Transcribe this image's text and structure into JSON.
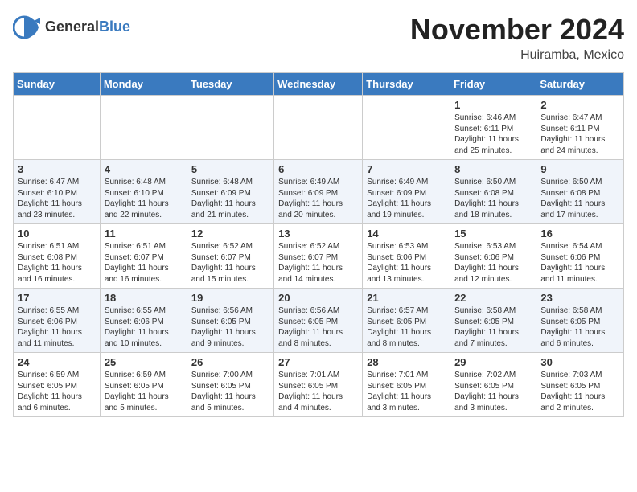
{
  "header": {
    "logo_general": "General",
    "logo_blue": "Blue",
    "month_title": "November 2024",
    "location": "Huiramba, Mexico"
  },
  "weekdays": [
    "Sunday",
    "Monday",
    "Tuesday",
    "Wednesday",
    "Thursday",
    "Friday",
    "Saturday"
  ],
  "weeks": [
    [
      {
        "day": "",
        "info": ""
      },
      {
        "day": "",
        "info": ""
      },
      {
        "day": "",
        "info": ""
      },
      {
        "day": "",
        "info": ""
      },
      {
        "day": "",
        "info": ""
      },
      {
        "day": "1",
        "info": "Sunrise: 6:46 AM\nSunset: 6:11 PM\nDaylight: 11 hours and 25 minutes."
      },
      {
        "day": "2",
        "info": "Sunrise: 6:47 AM\nSunset: 6:11 PM\nDaylight: 11 hours and 24 minutes."
      }
    ],
    [
      {
        "day": "3",
        "info": "Sunrise: 6:47 AM\nSunset: 6:10 PM\nDaylight: 11 hours and 23 minutes."
      },
      {
        "day": "4",
        "info": "Sunrise: 6:48 AM\nSunset: 6:10 PM\nDaylight: 11 hours and 22 minutes."
      },
      {
        "day": "5",
        "info": "Sunrise: 6:48 AM\nSunset: 6:09 PM\nDaylight: 11 hours and 21 minutes."
      },
      {
        "day": "6",
        "info": "Sunrise: 6:49 AM\nSunset: 6:09 PM\nDaylight: 11 hours and 20 minutes."
      },
      {
        "day": "7",
        "info": "Sunrise: 6:49 AM\nSunset: 6:09 PM\nDaylight: 11 hours and 19 minutes."
      },
      {
        "day": "8",
        "info": "Sunrise: 6:50 AM\nSunset: 6:08 PM\nDaylight: 11 hours and 18 minutes."
      },
      {
        "day": "9",
        "info": "Sunrise: 6:50 AM\nSunset: 6:08 PM\nDaylight: 11 hours and 17 minutes."
      }
    ],
    [
      {
        "day": "10",
        "info": "Sunrise: 6:51 AM\nSunset: 6:08 PM\nDaylight: 11 hours and 16 minutes."
      },
      {
        "day": "11",
        "info": "Sunrise: 6:51 AM\nSunset: 6:07 PM\nDaylight: 11 hours and 16 minutes."
      },
      {
        "day": "12",
        "info": "Sunrise: 6:52 AM\nSunset: 6:07 PM\nDaylight: 11 hours and 15 minutes."
      },
      {
        "day": "13",
        "info": "Sunrise: 6:52 AM\nSunset: 6:07 PM\nDaylight: 11 hours and 14 minutes."
      },
      {
        "day": "14",
        "info": "Sunrise: 6:53 AM\nSunset: 6:06 PM\nDaylight: 11 hours and 13 minutes."
      },
      {
        "day": "15",
        "info": "Sunrise: 6:53 AM\nSunset: 6:06 PM\nDaylight: 11 hours and 12 minutes."
      },
      {
        "day": "16",
        "info": "Sunrise: 6:54 AM\nSunset: 6:06 PM\nDaylight: 11 hours and 11 minutes."
      }
    ],
    [
      {
        "day": "17",
        "info": "Sunrise: 6:55 AM\nSunset: 6:06 PM\nDaylight: 11 hours and 11 minutes."
      },
      {
        "day": "18",
        "info": "Sunrise: 6:55 AM\nSunset: 6:06 PM\nDaylight: 11 hours and 10 minutes."
      },
      {
        "day": "19",
        "info": "Sunrise: 6:56 AM\nSunset: 6:05 PM\nDaylight: 11 hours and 9 minutes."
      },
      {
        "day": "20",
        "info": "Sunrise: 6:56 AM\nSunset: 6:05 PM\nDaylight: 11 hours and 8 minutes."
      },
      {
        "day": "21",
        "info": "Sunrise: 6:57 AM\nSunset: 6:05 PM\nDaylight: 11 hours and 8 minutes."
      },
      {
        "day": "22",
        "info": "Sunrise: 6:58 AM\nSunset: 6:05 PM\nDaylight: 11 hours and 7 minutes."
      },
      {
        "day": "23",
        "info": "Sunrise: 6:58 AM\nSunset: 6:05 PM\nDaylight: 11 hours and 6 minutes."
      }
    ],
    [
      {
        "day": "24",
        "info": "Sunrise: 6:59 AM\nSunset: 6:05 PM\nDaylight: 11 hours and 6 minutes."
      },
      {
        "day": "25",
        "info": "Sunrise: 6:59 AM\nSunset: 6:05 PM\nDaylight: 11 hours and 5 minutes."
      },
      {
        "day": "26",
        "info": "Sunrise: 7:00 AM\nSunset: 6:05 PM\nDaylight: 11 hours and 5 minutes."
      },
      {
        "day": "27",
        "info": "Sunrise: 7:01 AM\nSunset: 6:05 PM\nDaylight: 11 hours and 4 minutes."
      },
      {
        "day": "28",
        "info": "Sunrise: 7:01 AM\nSunset: 6:05 PM\nDaylight: 11 hours and 3 minutes."
      },
      {
        "day": "29",
        "info": "Sunrise: 7:02 AM\nSunset: 6:05 PM\nDaylight: 11 hours and 3 minutes."
      },
      {
        "day": "30",
        "info": "Sunrise: 7:03 AM\nSunset: 6:05 PM\nDaylight: 11 hours and 2 minutes."
      }
    ]
  ]
}
